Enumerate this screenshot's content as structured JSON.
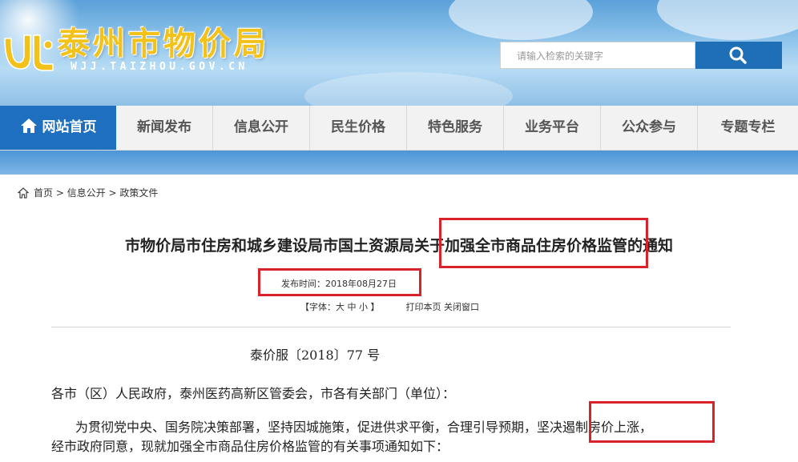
{
  "header": {
    "site_title": "泰州市物价局",
    "site_url": "WJJ.TAIZHOU.GOV.CN",
    "search_placeholder": "请输入检索的关键字"
  },
  "nav": {
    "items": [
      {
        "label": "网站首页",
        "active": true
      },
      {
        "label": "新闻发布"
      },
      {
        "label": "信息公开"
      },
      {
        "label": "民生价格"
      },
      {
        "label": "特色服务"
      },
      {
        "label": "业务平台"
      },
      {
        "label": "公众参与"
      },
      {
        "label": "专题专栏"
      }
    ]
  },
  "breadcrumb": [
    "首页",
    "信息公开",
    "政策文件"
  ],
  "article": {
    "title": "市物价局市住房和城乡建设局市国土资源局关于加强全市商品住房价格监管的通知",
    "publish_time": "发布时间：2018年08月27日",
    "font_size_label": "【字体：大 中 小 】",
    "print_label": "打印本页",
    "close_label": "关闭窗口",
    "doc_number": "泰价服〔2018〕77 号",
    "recipients": "各市（区）人民政府，泰州医药高新区管委会，市各有关部门（单位）：",
    "para1_line1": "为贯彻党中央、国务院决策部署，坚持因城施策，促进供求平衡，合理引导预期，坚决遏制房价上涨，",
    "para1_line2": "经市政府同意，现就加强全市商品住房价格监管的有关事项通知如下："
  },
  "colors": {
    "accent_blue": "#1e6fbf",
    "title_gold": "#f2c21b",
    "highlight_red": "#d8232a"
  },
  "icons": {
    "search": "search-icon",
    "home": "home-icon",
    "breadcrumb_home": "breadcrumb-home-icon"
  }
}
